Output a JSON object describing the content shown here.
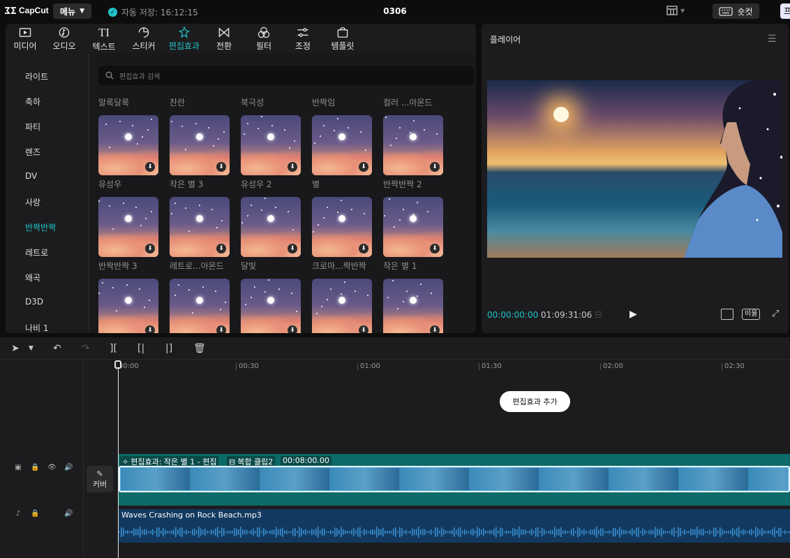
{
  "topbar": {
    "logo": "CapCut",
    "menu_label": "메뉴",
    "autosave": "자동 저장: 16:12:15",
    "project_title": "0306",
    "shortcut_label": "숏컷",
    "edge_label": "프"
  },
  "toolbar": {
    "tabs": [
      {
        "label": "미디어",
        "icon": "media-icon"
      },
      {
        "label": "오디오",
        "icon": "audio-icon"
      },
      {
        "label": "텍스트",
        "icon": "text-icon"
      },
      {
        "label": "스티커",
        "icon": "sticker-icon"
      },
      {
        "label": "편집효과",
        "icon": "effects-icon",
        "active": true
      },
      {
        "label": "전환",
        "icon": "transition-icon"
      },
      {
        "label": "필터",
        "icon": "filter-icon"
      },
      {
        "label": "조정",
        "icon": "adjust-icon"
      },
      {
        "label": "템플릿",
        "icon": "template-icon"
      }
    ]
  },
  "categories": [
    "라이트",
    "축하",
    "파티",
    "렌즈",
    "DV",
    "사랑",
    "반짝반짝",
    "레트로",
    "왜곡",
    "D3D",
    "나비 1"
  ],
  "active_category": "반짝반짝",
  "search": {
    "placeholder": "편집효과 검색"
  },
  "effects": {
    "row1_labels": [
      "알록달록",
      "찬란",
      "북극성",
      "반짝임",
      "컬러 ...아몬드"
    ],
    "row2_labels": [
      "유성우",
      "작은 별 3",
      "유성우 2",
      "별",
      "반짝반짝 2"
    ],
    "row3_labels": [
      "반짝반짝 3",
      "레트로...아몬드",
      "달빛",
      "크로마...짝반짝",
      "작은 별 1"
    ]
  },
  "player": {
    "title": "플레이어",
    "current_time": "00:00:00:00",
    "total_time": "01:09:31:06",
    "ratio_label": "비율"
  },
  "timeline": {
    "ruler": [
      "00:00",
      "00:30",
      "01:00",
      "01:30",
      "02:00",
      "02:30"
    ],
    "add_effect_label": "편집효과 추가",
    "cover_label": "커버",
    "effect_clip_label": "편집효과: 작은 별 1 - 편집",
    "compound_label": "복합 클립2",
    "compound_duration": "00:08:00.00",
    "audio_clip_label": "Waves Crashing on Rock Beach.mp3"
  },
  "colors": {
    "accent": "#23c3c8",
    "effect_track": "#0c6a68",
    "audio_track": "#123a60"
  }
}
